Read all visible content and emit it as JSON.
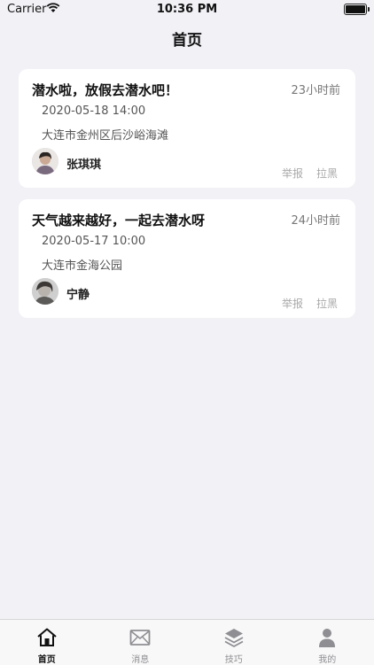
{
  "status_bar": {
    "carrier": "Carrier",
    "time": "10:36 PM"
  },
  "nav": {
    "title": "首页"
  },
  "posts": [
    {
      "title": "潜水啦，放假去潜水吧！",
      "relative_time": "23小时前",
      "date": "2020-05-18 14:00",
      "location": "大连市金州区后沙峪海滩",
      "user": "张琪琪",
      "report_label": "举报",
      "block_label": "拉黑"
    },
    {
      "title": "天气越来越好，一起去潜水呀",
      "relative_time": "24小时前",
      "date": "2020-05-17 10:00",
      "location": "大连市金海公园",
      "user": "宁静",
      "report_label": "举报",
      "block_label": "拉黑"
    }
  ],
  "tab_bar": {
    "tabs": [
      {
        "label": "首页",
        "icon": "home-icon",
        "active": true
      },
      {
        "label": "消息",
        "icon": "mail-icon",
        "active": false
      },
      {
        "label": "技巧",
        "icon": "layers-icon",
        "active": false
      },
      {
        "label": "我的",
        "icon": "person-icon",
        "active": false
      }
    ]
  }
}
